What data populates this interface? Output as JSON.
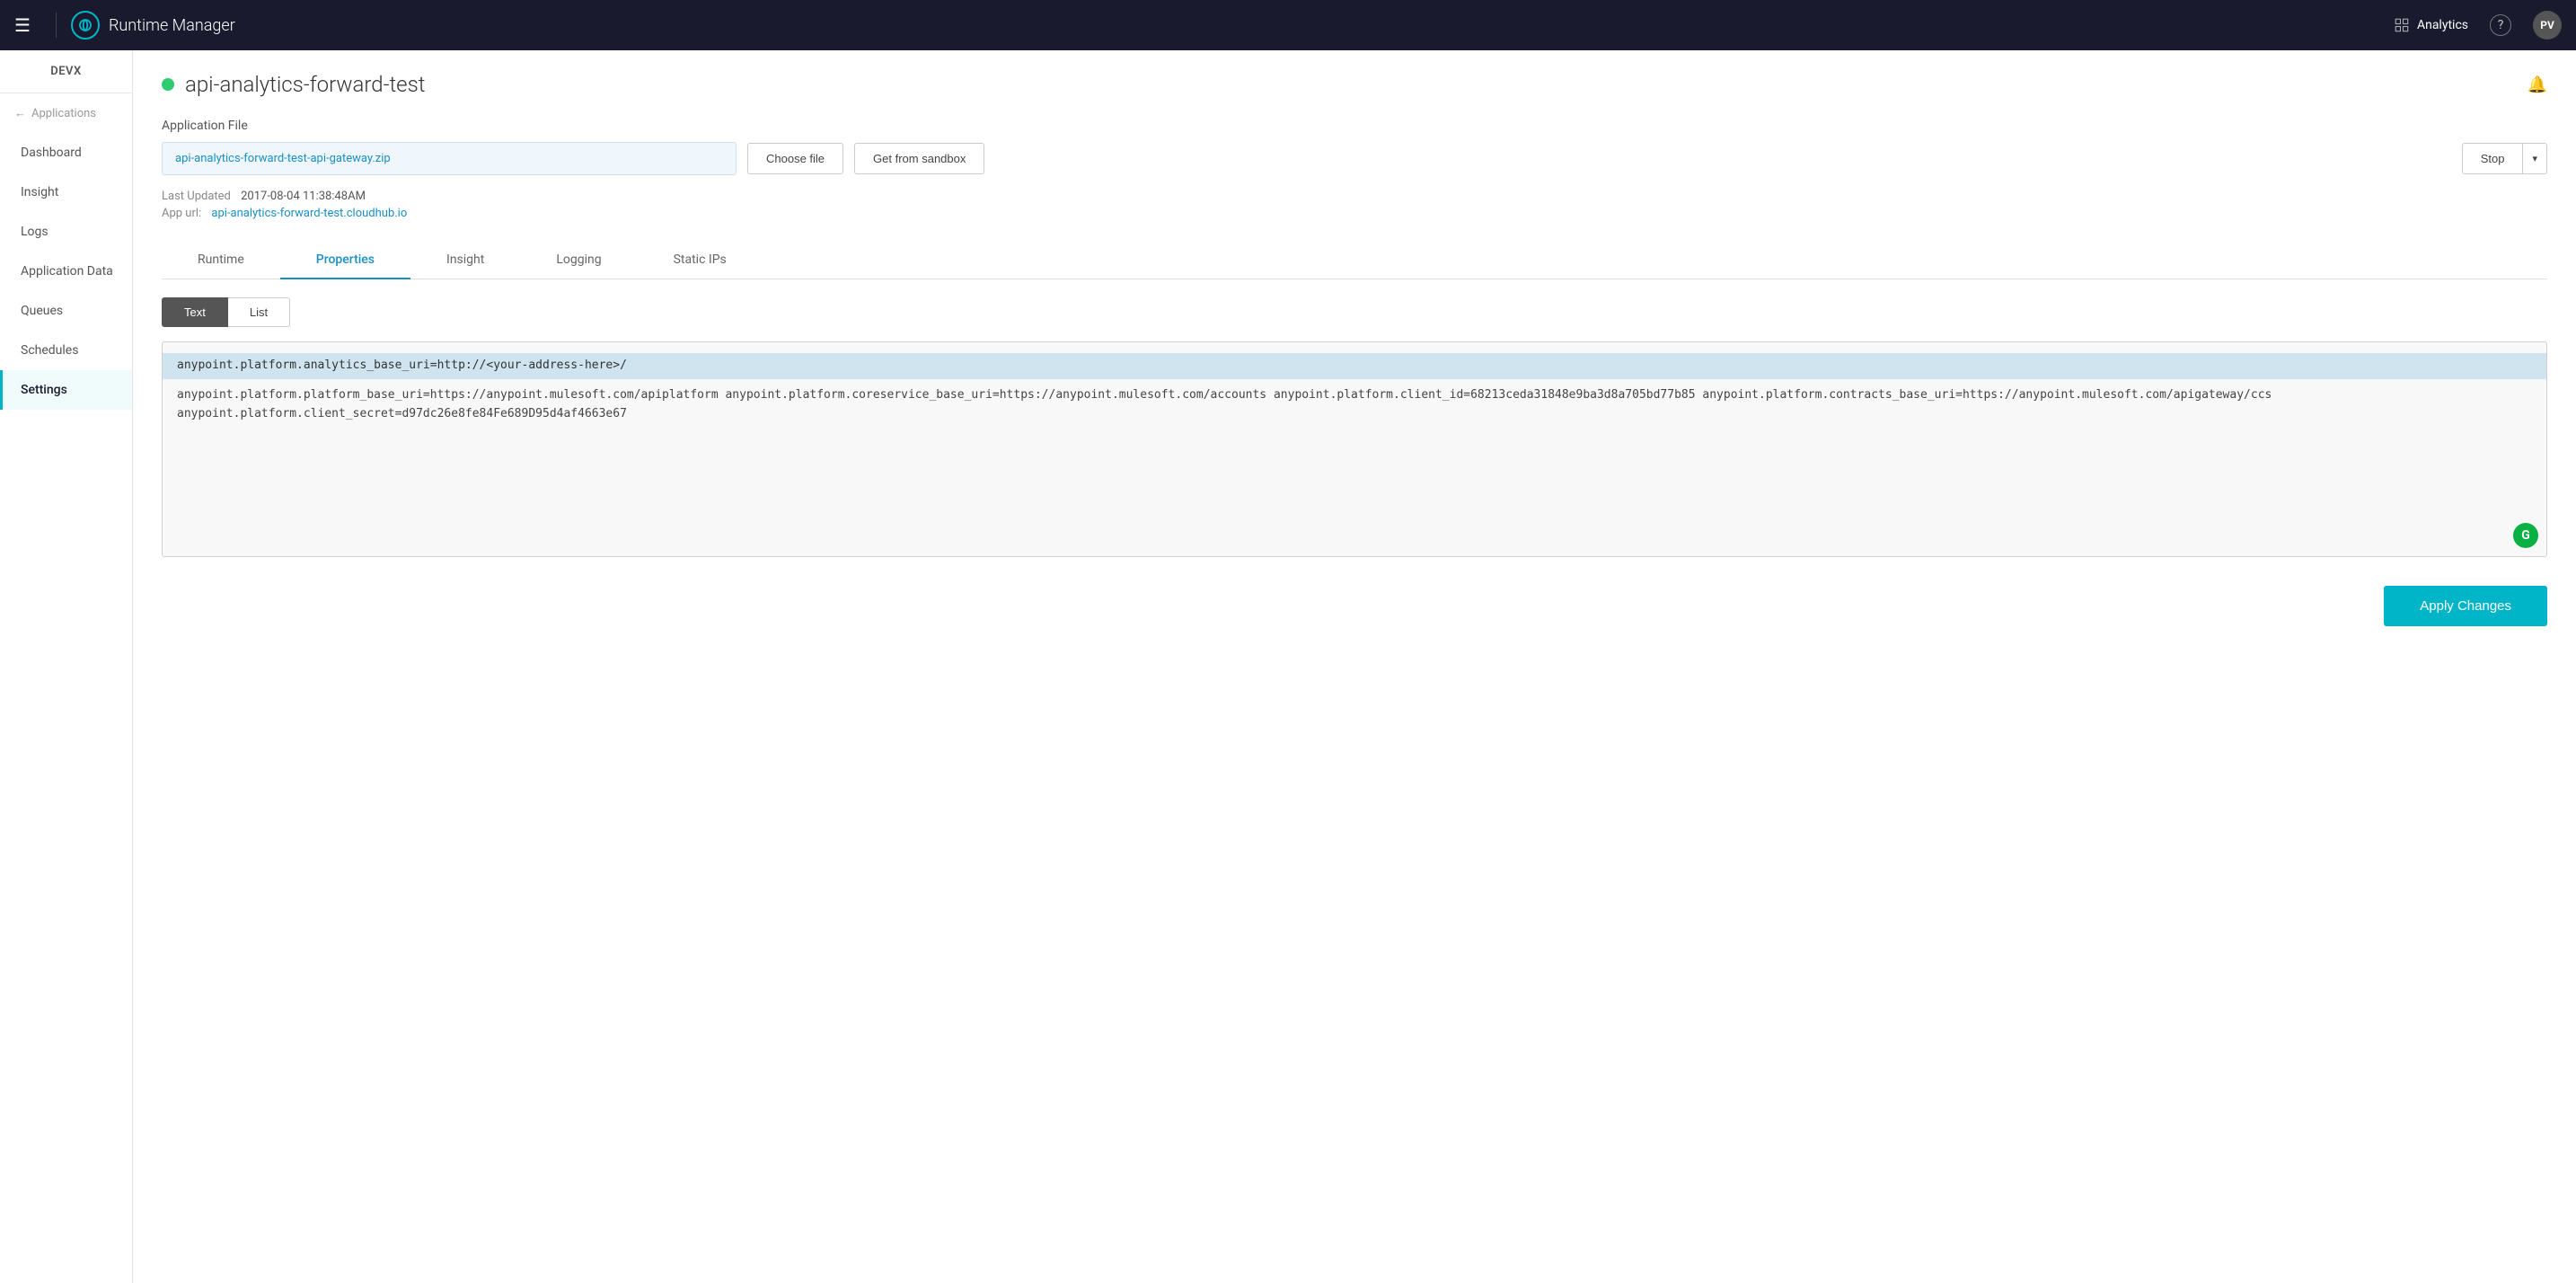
{
  "topNav": {
    "hamburger": "☰",
    "appTitle": "Runtime Manager",
    "analyticsLabel": "Analytics",
    "helpLabel": "?",
    "avatarLabel": "PV"
  },
  "sidebar": {
    "orgLabel": "DEVX",
    "backLabel": "Applications",
    "navItems": [
      {
        "label": "Dashboard",
        "active": false
      },
      {
        "label": "Insight",
        "active": false
      },
      {
        "label": "Logs",
        "active": false
      },
      {
        "label": "Application Data",
        "active": false
      },
      {
        "label": "Queues",
        "active": false
      },
      {
        "label": "Schedules",
        "active": false
      },
      {
        "label": "Settings",
        "active": true
      }
    ]
  },
  "app": {
    "name": "api-analytics-forward-test",
    "status": "running",
    "statusColor": "#2ecc71"
  },
  "applicationFile": {
    "label": "Application File",
    "fileName": "api-analytics-forward-test-api-gateway.zip",
    "chooseFileLabel": "Choose file",
    "getFromSandboxLabel": "Get from sandbox",
    "stopLabel": "Stop",
    "lastUpdatedLabel": "Last Updated",
    "lastUpdatedValue": "2017-08-04 11:38:48AM",
    "appUrlLabel": "App url:",
    "appUrlValue": "api-analytics-forward-test.cloudhub.io"
  },
  "tabs": [
    {
      "label": "Runtime",
      "active": false
    },
    {
      "label": "Properties",
      "active": true
    },
    {
      "label": "Insight",
      "active": false
    },
    {
      "label": "Logging",
      "active": false
    },
    {
      "label": "Static IPs",
      "active": false
    }
  ],
  "propertiesPanel": {
    "textToggleLabel": "Text",
    "listToggleLabel": "List",
    "highlightedLine": "anypoint.platform.analytics_base_uri=http://<your-address-here>/",
    "textContent": "anypoint.platform.platform_base_uri=https://anypoint.mulesoft.com/apiplatform\nanypoint.platform.coreservice_base_uri=https://anypoint.mulesoft.com/accounts\nanypoint.platform.client_id=68213ceda31848e9ba3d8a705bd77b85\nanypoint.platform.contracts_base_uri=https://anypoint.mulesoft.com/apigateway/ccs\nanypoint.platform.client_secret=d97dc26e8fe84Fe689D95d4af4663e67"
  },
  "footer": {
    "applyChangesLabel": "Apply Changes"
  }
}
